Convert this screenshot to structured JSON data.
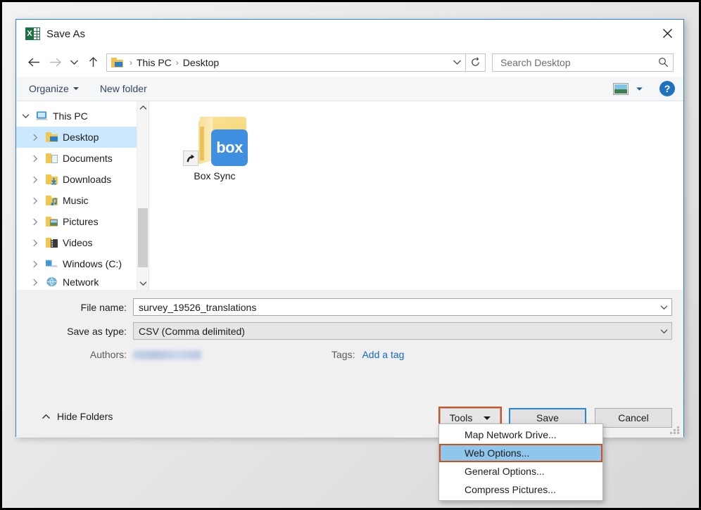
{
  "window": {
    "title": "Save As",
    "app_icon": "excel-icon",
    "close_label": "✕"
  },
  "navigation": {
    "back_icon": "back-arrow-icon",
    "forward_icon": "forward-arrow-icon",
    "recent_icon": "chevron-down-icon",
    "up_icon": "up-arrow-icon",
    "breadcrumb": [
      "This PC",
      "Desktop"
    ],
    "breadcrumb_separator": "›",
    "address_chevron": "chevron-down-icon",
    "refresh_icon": "refresh-icon"
  },
  "search": {
    "placeholder": "Search Desktop",
    "value": "",
    "icon": "search-icon"
  },
  "commandbar": {
    "organize_label": "Organize",
    "new_folder_label": "New folder",
    "view_icon": "view-mode-icon",
    "view_caret_icon": "chevron-down-icon",
    "help_label": "?"
  },
  "navpane": {
    "tree": [
      {
        "label": "This PC",
        "depth": 0,
        "expander": "chevron-down-icon",
        "icon": "this-pc-icon",
        "selected": false
      },
      {
        "label": "Desktop",
        "depth": 1,
        "expander": "chevron-right-icon",
        "icon": "desktop-folder-icon",
        "selected": true
      },
      {
        "label": "Documents",
        "depth": 1,
        "expander": "chevron-right-icon",
        "icon": "documents-folder-icon",
        "selected": false
      },
      {
        "label": "Downloads",
        "depth": 1,
        "expander": "chevron-right-icon",
        "icon": "downloads-folder-icon",
        "selected": false
      },
      {
        "label": "Music",
        "depth": 1,
        "expander": "chevron-right-icon",
        "icon": "music-folder-icon",
        "selected": false
      },
      {
        "label": "Pictures",
        "depth": 1,
        "expander": "chevron-right-icon",
        "icon": "pictures-folder-icon",
        "selected": false
      },
      {
        "label": "Videos",
        "depth": 1,
        "expander": "chevron-right-icon",
        "icon": "videos-folder-icon",
        "selected": false
      },
      {
        "label": "Windows (C:)",
        "depth": 1,
        "expander": "chevron-right-icon",
        "icon": "drive-icon",
        "selected": false
      },
      {
        "label": "Network",
        "depth": 1,
        "expander": "chevron-right-icon",
        "icon": "network-icon",
        "selected": false
      }
    ],
    "scrollbar": {
      "up_icon": "chevron-up-icon",
      "down_icon": "chevron-down-icon"
    }
  },
  "filepane": {
    "items": [
      {
        "label": "Box Sync",
        "icon": "folder-shortcut-icon",
        "overlay_text": "box"
      }
    ]
  },
  "form": {
    "filename_label": "File name:",
    "filename_value": "survey_19526_translations",
    "filetype_label": "Save as type:",
    "filetype_value": "CSV (Comma delimited)",
    "authors_label": "Authors:",
    "authors_value": "",
    "tags_label": "Tags:",
    "tags_link": "Add a tag",
    "combo_caret_icon": "chevron-down-icon"
  },
  "footer": {
    "hide_folders_label": "Hide Folders",
    "hide_folders_icon": "chevron-up-icon",
    "tools_label": "Tools",
    "save_label": "Save",
    "cancel_label": "Cancel",
    "resize_grip_icon": "resize-grip-icon"
  },
  "tools_menu": {
    "items": [
      {
        "label": "Map Network Drive...",
        "highlighted": false
      },
      {
        "label": "Web Options...",
        "highlighted": true
      },
      {
        "label": "General Options...",
        "highlighted": false
      },
      {
        "label": "Compress Pictures...",
        "highlighted": false
      }
    ]
  },
  "colors": {
    "accent_blue": "#2b87d6",
    "selection_blue": "#cce8ff",
    "menu_highlight": "#8fc7ec",
    "annotation_orange": "#d1501f",
    "link_blue": "#1769c0",
    "excel_green": "#1d7044",
    "box_blue": "#3f8fe0"
  }
}
